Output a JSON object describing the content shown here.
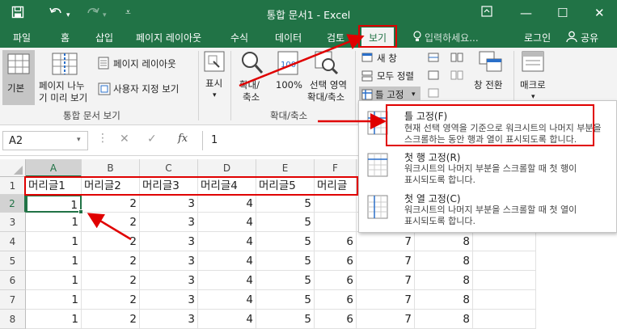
{
  "titlebar": {
    "title": "통합 문서1 - Excel"
  },
  "tabs": [
    "파일",
    "홈",
    "삽입",
    "페이지 레이아웃",
    "수식",
    "데이터",
    "검토",
    "보기"
  ],
  "search": {
    "placeholder": "입력하세요..."
  },
  "account": {
    "login": "로그인",
    "share": "공유"
  },
  "ribbon": {
    "normal": "기본",
    "page_break_1": "페이지 나누",
    "page_break_2": "기 미리 보기",
    "page_layout": "페이지 레이아웃",
    "custom_view": "사용자 지정 보기",
    "views_group": "통합 문서 보기",
    "show": "표시",
    "zoom_1": "확대/",
    "zoom_2": "축소",
    "zoom100": "100%",
    "zoom_sel_1": "선택 영역",
    "zoom_sel_2": "확대/축소",
    "zoom_group": "확대/축소",
    "new_window": "새 창",
    "arrange_all": "모두 정렬",
    "freeze_panes": "틀 고정",
    "switch_windows": "창 전환",
    "macros": "매크로"
  },
  "formula": {
    "namebox": "A2",
    "value": "1"
  },
  "grid": {
    "columns": [
      "A",
      "B",
      "C",
      "D",
      "E",
      "F",
      "G",
      "H",
      "I"
    ],
    "rows": [
      {
        "n": "1",
        "cells": [
          "머리글1",
          "머리글2",
          "머리글3",
          "머리글4",
          "머리글5",
          "머리글",
          "",
          "",
          ""
        ]
      },
      {
        "n": "2",
        "cells": [
          "1",
          "2",
          "3",
          "4",
          "5",
          "",
          "",
          "",
          ""
        ]
      },
      {
        "n": "3",
        "cells": [
          "1",
          "2",
          "3",
          "4",
          "5",
          "",
          "",
          "",
          ""
        ]
      },
      {
        "n": "4",
        "cells": [
          "1",
          "2",
          "3",
          "4",
          "5",
          "6",
          "7",
          "8",
          ""
        ]
      },
      {
        "n": "5",
        "cells": [
          "1",
          "2",
          "3",
          "4",
          "5",
          "6",
          "7",
          "8",
          ""
        ]
      },
      {
        "n": "6",
        "cells": [
          "1",
          "2",
          "3",
          "4",
          "5",
          "6",
          "7",
          "8",
          ""
        ]
      },
      {
        "n": "7",
        "cells": [
          "1",
          "2",
          "3",
          "4",
          "5",
          "6",
          "7",
          "8",
          ""
        ]
      },
      {
        "n": "8",
        "cells": [
          "1",
          "2",
          "3",
          "4",
          "5",
          "6",
          "7",
          "8",
          ""
        ]
      }
    ]
  },
  "dropdown": {
    "items": [
      {
        "title": "틀 고정(F)",
        "desc1": "현재 선택 영역을 기준으로 워크시트의 나머지 부분을",
        "desc2": "스크롤하는 동안 행과 열이 표시되도록 합니다."
      },
      {
        "title": "첫 행 고정(R)",
        "desc1": "워크시트의 나머지 부분을 스크롤할 때 첫 행이",
        "desc2": "표시되도록 합니다."
      },
      {
        "title": "첫 열 고정(C)",
        "desc1": "워크시트의 나머지 부분을 스크롤할 때 첫 열이",
        "desc2": "표시되도록 합니다."
      }
    ]
  },
  "colors": {
    "excel_green": "#217346",
    "annotation_red": "#e00000"
  }
}
